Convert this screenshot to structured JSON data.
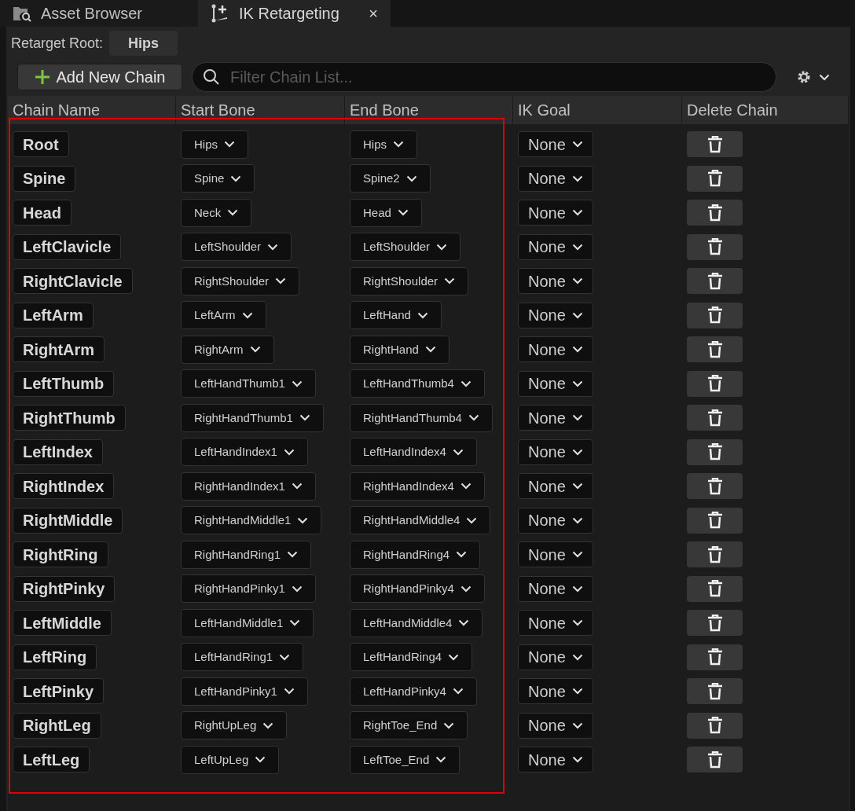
{
  "tabs": [
    {
      "label": "Asset Browser",
      "kind": "browser",
      "selected": false
    },
    {
      "label": "IK Retargeting",
      "kind": "ik",
      "selected": true,
      "close": "×"
    }
  ],
  "retarget_root": {
    "label": "Retarget Root:",
    "value": "Hips"
  },
  "toolbar": {
    "add_button": "Add New Chain",
    "search": {
      "placeholder": "Filter Chain List..."
    }
  },
  "table": {
    "columns": [
      "Chain Name",
      "Start Bone",
      "End Bone",
      "IK Goal",
      "Delete Chain"
    ],
    "rows": [
      {
        "name": "Root",
        "start": "Hips",
        "end": "Hips",
        "goal": "None"
      },
      {
        "name": "Spine",
        "start": "Spine",
        "end": "Spine2",
        "goal": "None"
      },
      {
        "name": "Head",
        "start": "Neck",
        "end": "Head",
        "goal": "None"
      },
      {
        "name": "LeftClavicle",
        "start": "LeftShoulder",
        "end": "LeftShoulder",
        "goal": "None"
      },
      {
        "name": "RightClavicle",
        "start": "RightShoulder",
        "end": "RightShoulder",
        "goal": "None"
      },
      {
        "name": "LeftArm",
        "start": "LeftArm",
        "end": "LeftHand",
        "goal": "None"
      },
      {
        "name": "RightArm",
        "start": "RightArm",
        "end": "RightHand",
        "goal": "None"
      },
      {
        "name": "LeftThumb",
        "start": "LeftHandThumb1",
        "end": "LeftHandThumb4",
        "goal": "None"
      },
      {
        "name": "RightThumb",
        "start": "RightHandThumb1",
        "end": "RightHandThumb4",
        "goal": "None"
      },
      {
        "name": "LeftIndex",
        "start": "LeftHandIndex1",
        "end": "LeftHandIndex4",
        "goal": "None"
      },
      {
        "name": "RightIndex",
        "start": "RightHandIndex1",
        "end": "RightHandIndex4",
        "goal": "None"
      },
      {
        "name": "RightMiddle",
        "start": "RightHandMiddle1",
        "end": "RightHandMiddle4",
        "goal": "None"
      },
      {
        "name": "RightRing",
        "start": "RightHandRing1",
        "end": "RightHandRing4",
        "goal": "None"
      },
      {
        "name": "RightPinky",
        "start": "RightHandPinky1",
        "end": "RightHandPinky4",
        "goal": "None"
      },
      {
        "name": "LeftMiddle",
        "start": "LeftHandMiddle1",
        "end": "LeftHandMiddle4",
        "goal": "None"
      },
      {
        "name": "LeftRing",
        "start": "LeftHandRing1",
        "end": "LeftHandRing4",
        "goal": "None"
      },
      {
        "name": "LeftPinky",
        "start": "LeftHandPinky1",
        "end": "LeftHandPinky4",
        "goal": "None"
      },
      {
        "name": "RightLeg",
        "start": "RightUpLeg",
        "end": "RightToe_End",
        "goal": "None"
      },
      {
        "name": "LeftLeg",
        "start": "LeftUpLeg",
        "end": "LeftToe_End",
        "goal": "None"
      }
    ]
  }
}
